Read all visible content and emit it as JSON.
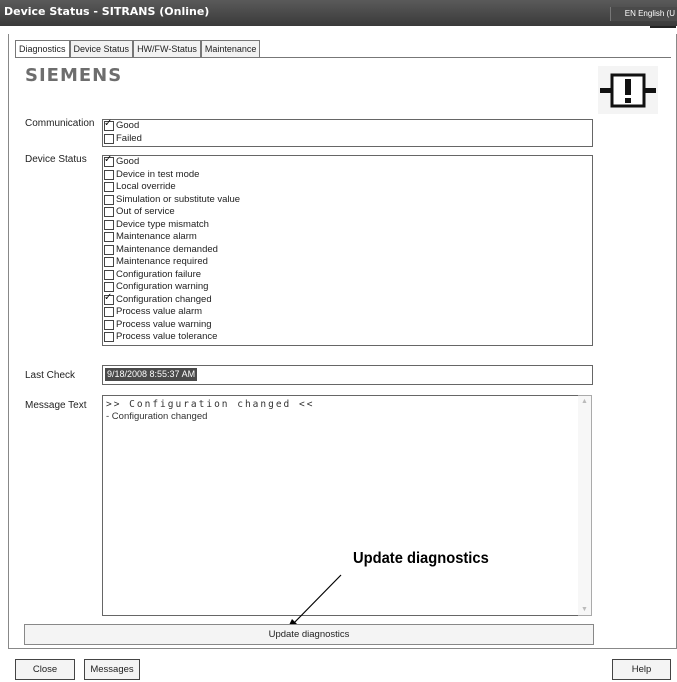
{
  "window": {
    "title": "Device Status - SITRANS  (Online)",
    "language": "EN English (U"
  },
  "tabs": [
    {
      "label": "Diagnostics",
      "active": true
    },
    {
      "label": "Device Status",
      "active": false
    },
    {
      "label": "HW/FW-Status",
      "active": false
    },
    {
      "label": "Maintenance",
      "active": false
    }
  ],
  "logo": "SIEMENS",
  "status_icon": "maintenance-warning-icon",
  "communication": {
    "label": "Communication",
    "items": [
      {
        "label": "Good",
        "checked": true
      },
      {
        "label": "Failed",
        "checked": false
      }
    ]
  },
  "device_status": {
    "label": "Device Status",
    "items": [
      {
        "label": "Good",
        "checked": true
      },
      {
        "label": "Device in test mode",
        "checked": false
      },
      {
        "label": "Local override",
        "checked": false
      },
      {
        "label": "Simulation or substitute value",
        "checked": false
      },
      {
        "label": "Out of service",
        "checked": false
      },
      {
        "label": "Device type mismatch",
        "checked": false
      },
      {
        "label": "Maintenance alarm",
        "checked": false
      },
      {
        "label": "Maintenance demanded",
        "checked": false
      },
      {
        "label": "Maintenance required",
        "checked": false
      },
      {
        "label": "Configuration failure",
        "checked": false
      },
      {
        "label": "Configuration warning",
        "checked": false
      },
      {
        "label": "Configuration changed",
        "checked": true
      },
      {
        "label": "Process value alarm",
        "checked": false
      },
      {
        "label": "Process value warning",
        "checked": false
      },
      {
        "label": "Process value tolerance",
        "checked": false
      }
    ]
  },
  "last_check": {
    "label": "Last Check",
    "value": "9/18/2008 8:55:37 AM"
  },
  "message_text": {
    "label": "Message Text",
    "line1": ">> Configuration changed <<",
    "line2": "- Configuration changed"
  },
  "callout": "Update diagnostics",
  "buttons": {
    "update": "Update diagnostics",
    "close": "Close",
    "messages": "Messages",
    "help": "Help"
  }
}
